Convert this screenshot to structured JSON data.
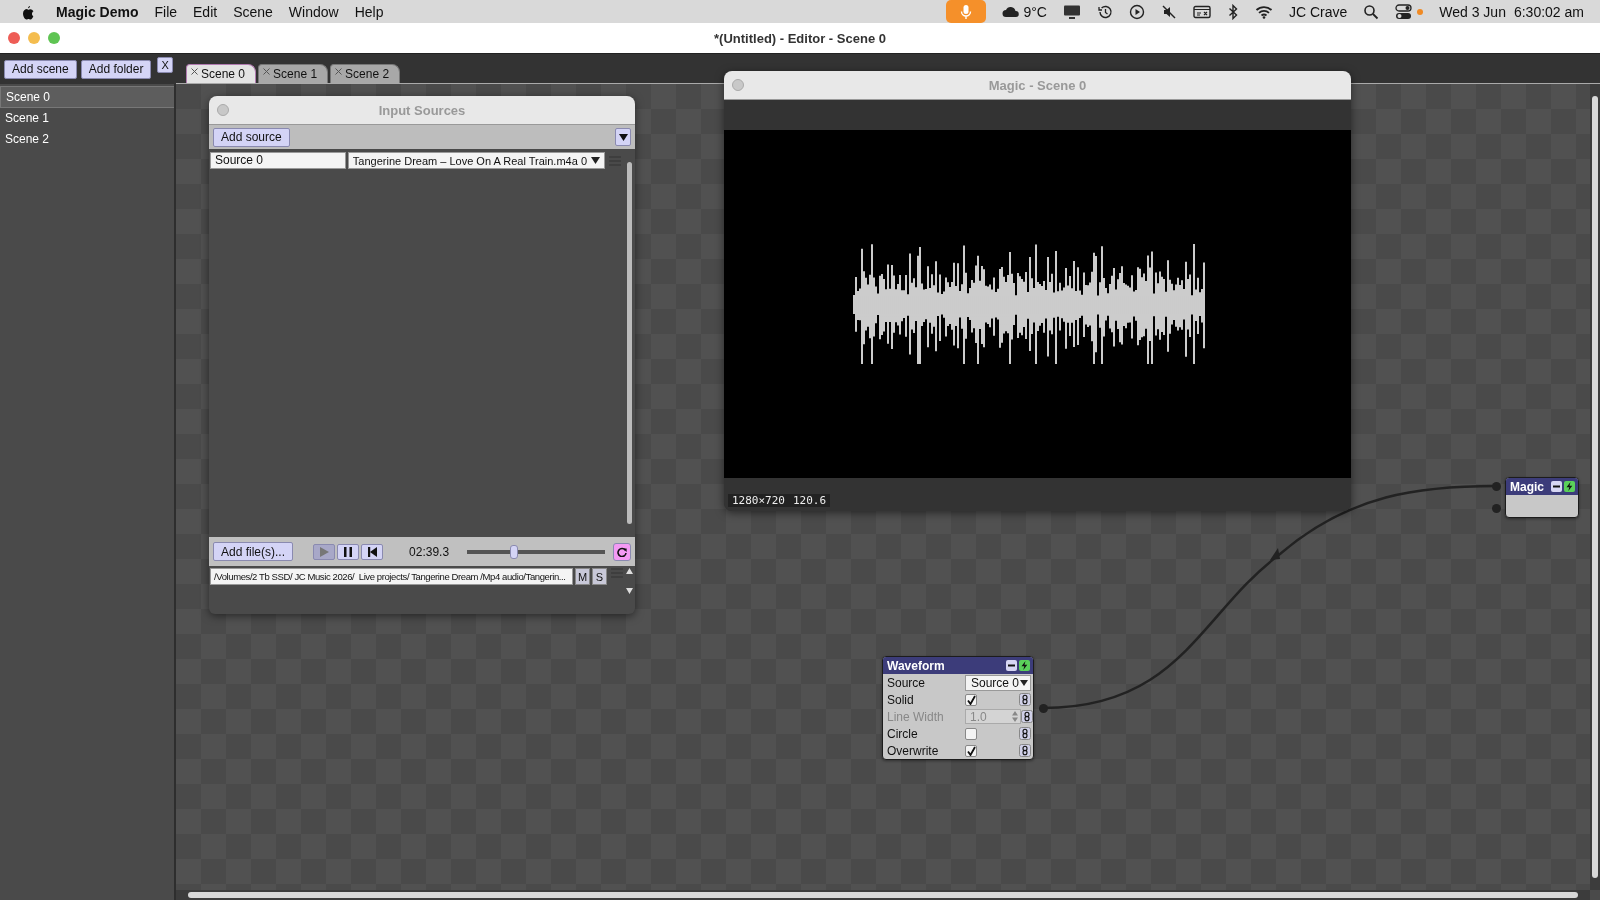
{
  "menu_bar": {
    "app": "Magic Demo",
    "menus": [
      "File",
      "Edit",
      "Scene",
      "Window",
      "Help"
    ],
    "weather": "9°C",
    "user": "JC Crave",
    "date": "Wed 3 Jun",
    "time": "6:30:02 am"
  },
  "window": {
    "title": "*(Untitled) - Editor - Scene 0"
  },
  "scene_panel": {
    "buttons": [
      "Add scene",
      "Add folder",
      "X"
    ],
    "scenes": [
      {
        "label": "Scene 0",
        "selected": true
      },
      {
        "label": "Scene 1",
        "selected": false
      },
      {
        "label": "Scene 2",
        "selected": false
      }
    ]
  },
  "tabs": [
    {
      "label": "Scene 0",
      "selected": true
    },
    {
      "label": "Scene 1",
      "selected": false
    },
    {
      "label": "Scene 2",
      "selected": false
    }
  ],
  "input_sources": {
    "title": "Input Sources",
    "add_button": "Add source",
    "sources": [
      {
        "name": "Source 0",
        "file": "Tangerine Dream – Love On A Real Train.m4a 0"
      }
    ],
    "add_files_button": "Add file(s)...",
    "playing": true,
    "time": "02:39.3",
    "position": {
      "level": 0.34
    },
    "loop": {
      "on": true
    },
    "path": "/Volumes/2 Tb SSD/ JC Music 2026/  Live projects/ Tangerine Dream /Mp4 audio/Tangerin...",
    "mute_button": "M",
    "solo_button": "S"
  },
  "preview": {
    "title": "Magic - Scene 0",
    "resolution": "1280×720",
    "fps": "120.6"
  },
  "waveform_node": {
    "title": "Waveform",
    "params": [
      {
        "kind": "select",
        "label": "Source",
        "value": "Source 0",
        "disabled": false
      },
      {
        "kind": "check",
        "label": "Solid",
        "checked": true,
        "disabled": false
      },
      {
        "kind": "number",
        "label": "Line Width",
        "value": "1.0",
        "disabled": true
      },
      {
        "kind": "check",
        "label": "Circle",
        "checked": false,
        "disabled": false
      },
      {
        "kind": "check",
        "label": "Overwrite",
        "checked": true,
        "disabled": false
      }
    ]
  },
  "magic_node": {
    "title": "Magic"
  }
}
